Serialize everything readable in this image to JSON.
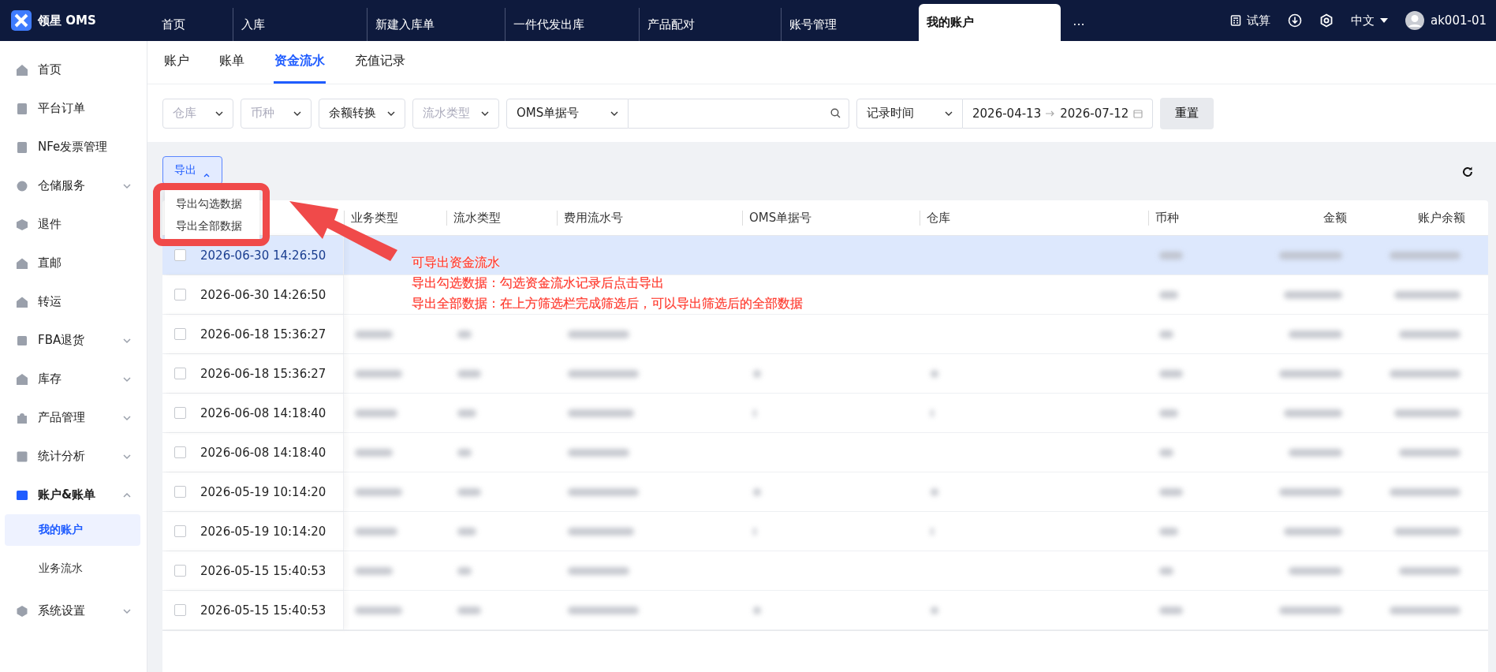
{
  "topbar": {
    "logo": "领星 OMS",
    "tabs": [
      {
        "label": "首页",
        "selected": false
      },
      {
        "label": "入库",
        "selected": false
      },
      {
        "label": "新建入库单",
        "selected": false
      },
      {
        "label": "一件代发出库",
        "selected": false
      },
      {
        "label": "产品配对",
        "selected": false
      },
      {
        "label": "账号管理",
        "selected": false
      },
      {
        "label": "我的账户",
        "selected": true
      }
    ],
    "more": "···",
    "trial": "试算",
    "language": "中文",
    "user": "ak001-01"
  },
  "sidebar": {
    "items": [
      {
        "label": "首页",
        "expandable": false,
        "expanded": false
      },
      {
        "label": "平台订单",
        "expandable": false,
        "expanded": false
      },
      {
        "label": "NFe发票管理",
        "expandable": false,
        "expanded": false
      },
      {
        "label": "仓储服务",
        "expandable": true,
        "expanded": false
      },
      {
        "label": "退件",
        "expandable": false,
        "expanded": false
      },
      {
        "label": "直邮",
        "expandable": false,
        "expanded": false
      },
      {
        "label": "转运",
        "expandable": false,
        "expanded": false
      },
      {
        "label": "FBA退货",
        "expandable": true,
        "expanded": false
      },
      {
        "label": "库存",
        "expandable": true,
        "expanded": false
      },
      {
        "label": "产品管理",
        "expandable": true,
        "expanded": false
      },
      {
        "label": "统计分析",
        "expandable": true,
        "expanded": false
      },
      {
        "label": "账户&账单",
        "expandable": true,
        "expanded": true,
        "children": [
          {
            "label": "我的账户",
            "selected": true
          },
          {
            "label": "业务流水",
            "selected": false
          }
        ]
      },
      {
        "label": "系统设置",
        "expandable": true,
        "expanded": false
      }
    ]
  },
  "subtabs": [
    {
      "label": "账户",
      "selected": false
    },
    {
      "label": "账单",
      "selected": false
    },
    {
      "label": "资金流水",
      "selected": true
    },
    {
      "label": "充值记录",
      "selected": false
    }
  ],
  "filters": {
    "selects": [
      {
        "placeholder": "仓库"
      },
      {
        "placeholder": "币种"
      },
      {
        "value": "余额转换"
      },
      {
        "placeholder": "流水类型"
      }
    ],
    "search_type": "OMS单据号",
    "time_type": "记录时间",
    "date_start": "2026-04-13",
    "date_end": "2026-07-12",
    "reset": "重置"
  },
  "export": {
    "label": "导出",
    "expanded": true,
    "menu": [
      "导出勾选数据",
      "导出全部数据"
    ]
  },
  "table": {
    "columns": [
      "业务类型",
      "流水类型",
      "费用流水号",
      "OMS单据号",
      "仓库",
      "币种",
      "金额",
      "账户余额"
    ],
    "rows": [
      {
        "date": "2026-06-30 14:26:50",
        "highlighted": true,
        "checked": false
      },
      {
        "date": "2026-06-30 14:26:50",
        "highlighted": false,
        "checked": false
      },
      {
        "date": "2026-06-18 15:36:27",
        "highlighted": false,
        "checked": false
      },
      {
        "date": "2026-06-18 15:36:27",
        "highlighted": false,
        "checked": false
      },
      {
        "date": "2026-06-08 14:18:40",
        "highlighted": false,
        "checked": false
      },
      {
        "date": "2026-06-08 14:18:40",
        "highlighted": false,
        "checked": false
      },
      {
        "date": "2026-05-19 10:14:20",
        "highlighted": false,
        "checked": false
      },
      {
        "date": "2026-05-19 10:14:20",
        "highlighted": false,
        "checked": false
      },
      {
        "date": "2026-05-15 15:40:53",
        "highlighted": false,
        "checked": false
      },
      {
        "date": "2026-05-15 15:40:53",
        "highlighted": false,
        "checked": false
      }
    ]
  },
  "annotation": [
    "可导出资金流水",
    "导出勾选数据：勾选资金流水记录后点击导出",
    "导出全部数据：在上方筛选栏完成筛选后，可以导出筛选后的全部数据"
  ]
}
